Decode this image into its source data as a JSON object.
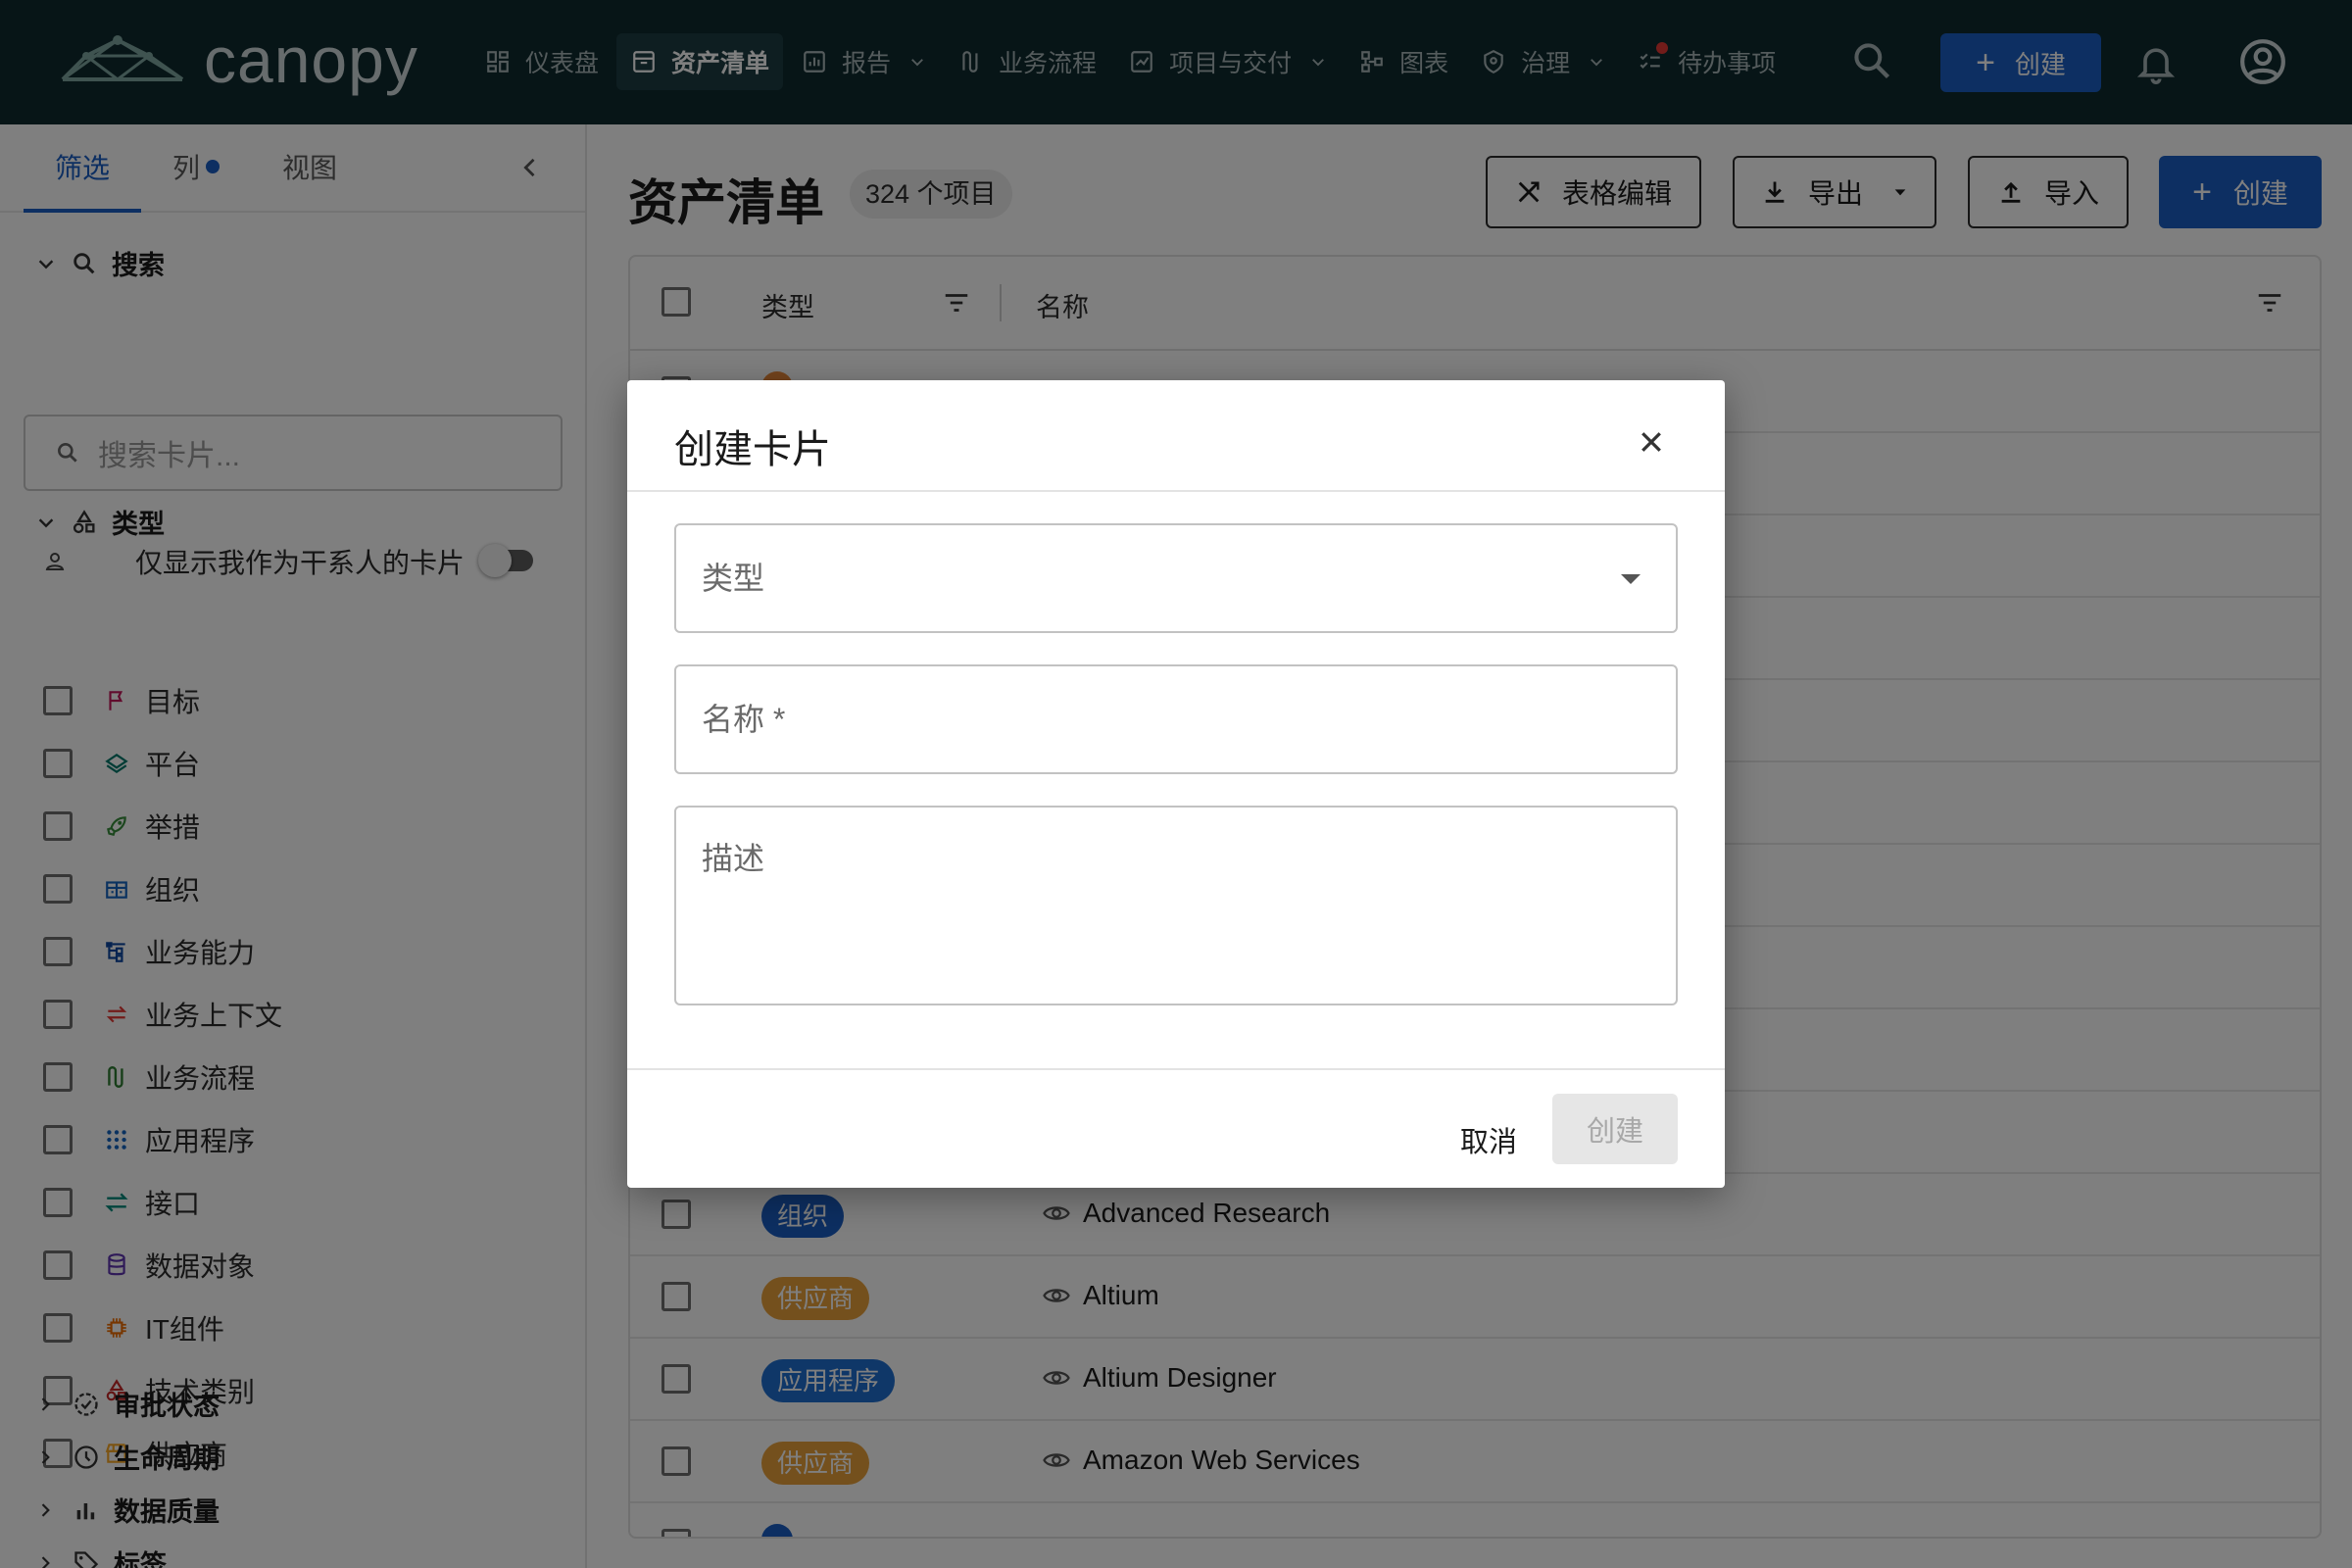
{
  "app": {
    "name": "canopy"
  },
  "nav": {
    "items": [
      {
        "label": "仪表盘",
        "icon": "dashboard-icon"
      },
      {
        "label": "资产清单",
        "icon": "inventory-icon",
        "active": true
      },
      {
        "label": "报告",
        "icon": "report-icon",
        "dropdown": true
      },
      {
        "label": "业务流程",
        "icon": "process-icon"
      },
      {
        "label": "项目与交付",
        "icon": "delivery-icon",
        "dropdown": true
      },
      {
        "label": "图表",
        "icon": "diagram-icon"
      },
      {
        "label": "治理",
        "icon": "shield-icon",
        "dropdown": true
      },
      {
        "label": "待办事项",
        "icon": "todo-icon",
        "notification": true
      }
    ],
    "create_label": "创建"
  },
  "sidebar": {
    "tabs": [
      {
        "label": "筛选"
      },
      {
        "label": "列"
      },
      {
        "label": "视图"
      }
    ],
    "search_section": "搜索",
    "search_placeholder": "搜索卡片...",
    "stakeholder_toggle": "仅显示我作为干系人的卡片",
    "type_section": "类型",
    "types": [
      {
        "label": "目标",
        "icon": "flag-icon",
        "color": "#c2185b"
      },
      {
        "label": "平台",
        "icon": "layers-icon",
        "color": "#00796b"
      },
      {
        "label": "举措",
        "icon": "rocket-icon",
        "color": "#388e3c"
      },
      {
        "label": "组织",
        "icon": "org-icon",
        "color": "#1565c0"
      },
      {
        "label": "业务能力",
        "icon": "capability-icon",
        "color": "#0d47a1"
      },
      {
        "label": "业务上下文",
        "icon": "context-icon",
        "color": "#e53935"
      },
      {
        "label": "业务流程",
        "icon": "process-icon",
        "color": "#2e7d32"
      },
      {
        "label": "应用程序",
        "icon": "apps-icon",
        "color": "#1565c0"
      },
      {
        "label": "接口",
        "icon": "interface-icon",
        "color": "#00897b"
      },
      {
        "label": "数据对象",
        "icon": "database-icon",
        "color": "#5e35b1"
      },
      {
        "label": "IT组件",
        "icon": "chip-icon",
        "color": "#ef6c00"
      },
      {
        "label": "技术类别",
        "icon": "category-icon",
        "color": "#c62828"
      },
      {
        "label": "供应商",
        "icon": "store-icon",
        "color": "#f9a825"
      }
    ],
    "collapsed_sections": [
      {
        "label": "审批状态",
        "icon": "approval-icon"
      },
      {
        "label": "生命周期",
        "icon": "clock-icon"
      },
      {
        "label": "数据质量",
        "icon": "bar-chart-icon"
      },
      {
        "label": "标签",
        "icon": "tag-icon"
      }
    ]
  },
  "main": {
    "title": "资产清单",
    "count": "324 个项目",
    "toolbar": {
      "grid_edit": "表格编辑",
      "export": "导出",
      "import": "导入",
      "create": "创建"
    },
    "columns": {
      "type": "类型",
      "name": "名称"
    },
    "rows": [
      {
        "type": "",
        "name": "",
        "color": "#e8883a"
      },
      {
        "type": "",
        "name": ""
      },
      {
        "type": "",
        "name": ""
      },
      {
        "type": "",
        "name": ""
      },
      {
        "type": "",
        "name": ""
      },
      {
        "type": "",
        "name": ""
      },
      {
        "type": "",
        "name": ""
      },
      {
        "type": "",
        "name": ""
      },
      {
        "type": "",
        "name": ""
      },
      {
        "type": "",
        "name": ""
      },
      {
        "type": "组织",
        "name": "Advanced Research",
        "color": "#1a5fc4"
      },
      {
        "type": "供应商",
        "name": "Altium",
        "color": "#e8a03a"
      },
      {
        "type": "应用程序",
        "name": "Altium Designer",
        "color": "#1f6fd1"
      },
      {
        "type": "供应商",
        "name": "Amazon Web Services",
        "color": "#e8a03a"
      },
      {
        "type": "",
        "name": "",
        "color": "#1a5fc4"
      }
    ]
  },
  "dialog": {
    "title": "创建卡片",
    "type_placeholder": "类型",
    "name_placeholder": "名称 *",
    "desc_placeholder": "描述",
    "cancel": "取消",
    "create": "创建"
  },
  "colors": {
    "topbar": "#0f2a2e",
    "accent": "#1a5fc4",
    "overlay": "rgba(0,0,0,0.5)"
  }
}
